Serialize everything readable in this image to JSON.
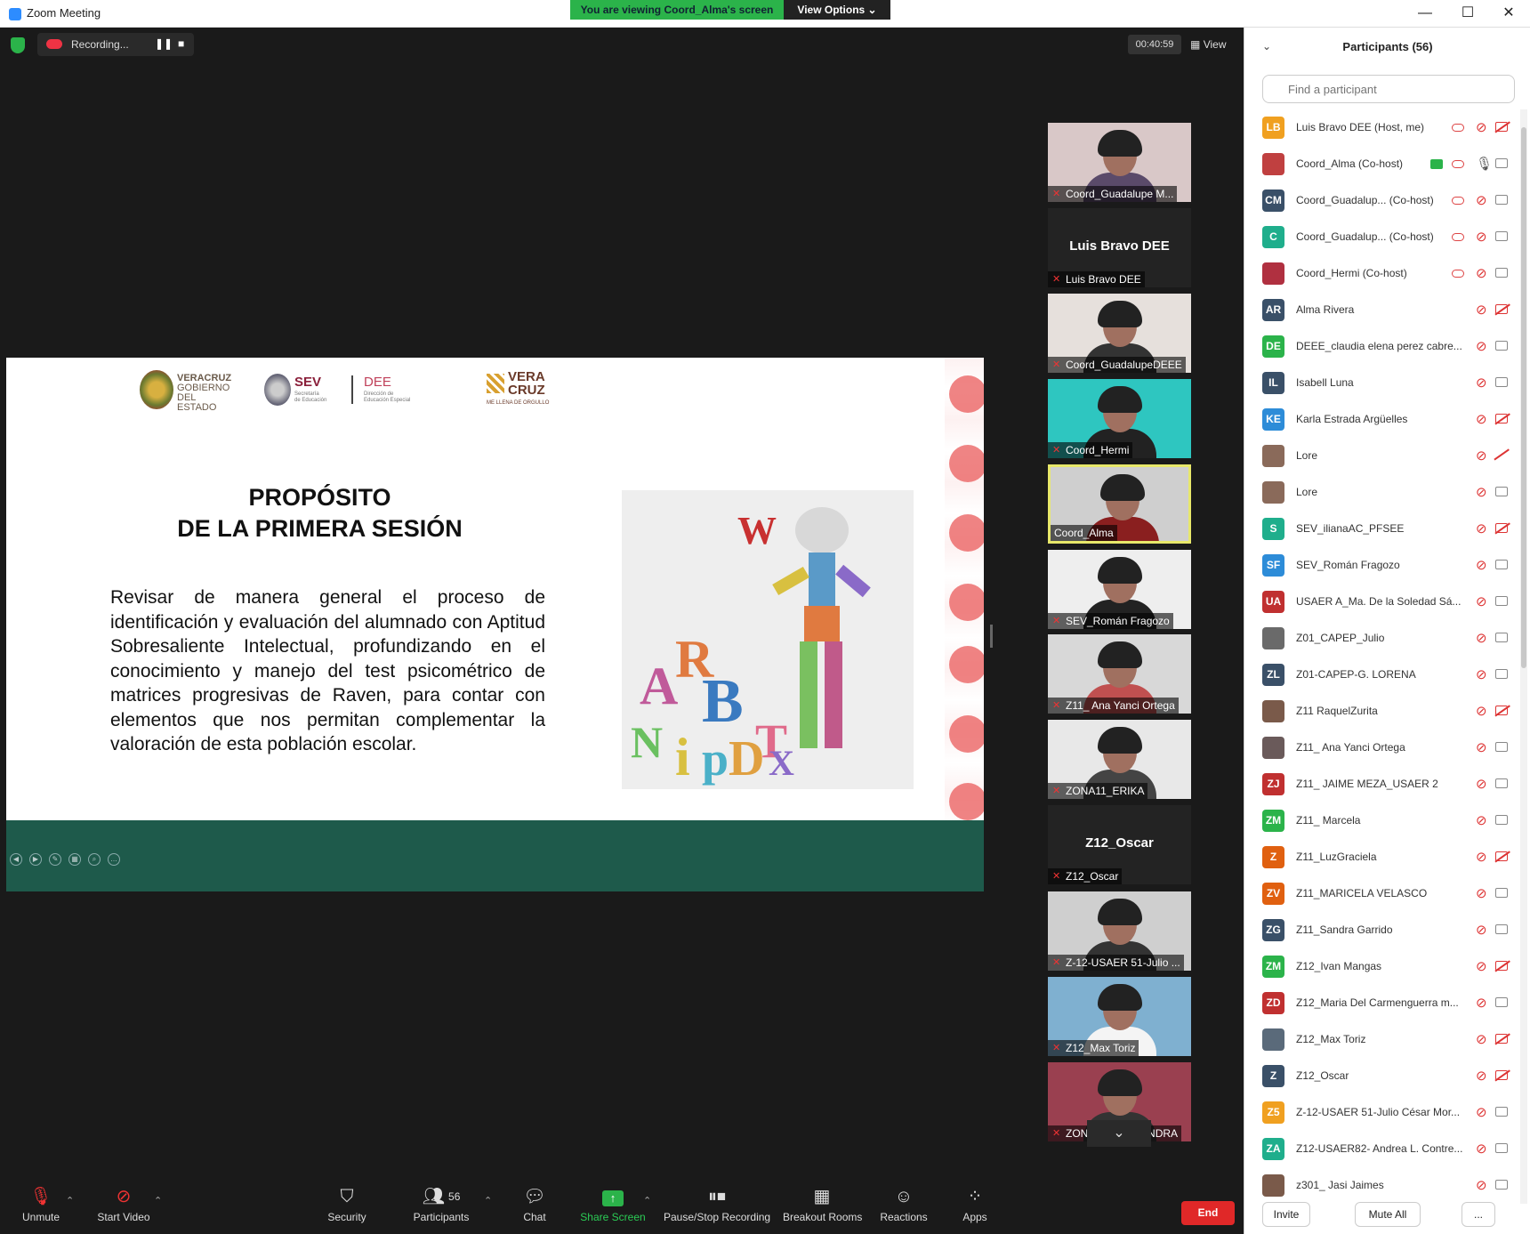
{
  "window": {
    "title": "Zoom Meeting",
    "minimize": "—",
    "maximize": "☐",
    "close": "✕"
  },
  "share_banner": {
    "viewing": "You are viewing Coord_Alma's screen",
    "view_options": "View Options ⌄"
  },
  "status": {
    "recording_label": "Recording...",
    "pause_icon": "❚❚",
    "stop_icon": "■",
    "timer": "00:40:59",
    "view_label": "View",
    "view_icon": "▦"
  },
  "slide": {
    "logos": {
      "veracruz": [
        "VERACRUZ",
        "GOBIERNO",
        "DEL ESTADO"
      ],
      "sev": "SEV",
      "sev_sub": [
        "Secretaría",
        "de Educación"
      ],
      "dee": "DEE",
      "dee_sub": [
        "Dirección de",
        "Educación Especial"
      ],
      "vera": "VERA",
      "cruz": "CRUZ",
      "vera_sub": "ME LLENA DE ORGULLO"
    },
    "heading_line1": "PROPÓSITO",
    "heading_line2": "DE LA PRIMERA SESIÓN",
    "body": "Revisar de manera general el proceso de identificación y evaluación del alumnado con Aptitud Sobresaliente Intelectual, profundizando en el conocimiento y manejo del test psicométrico de matrices progresivas de Raven, para contar con elementos que nos permitan complementar la valoración de esta población escolar."
  },
  "tiles": [
    {
      "name": "Coord_Guadalupe M...",
      "type": "video",
      "muted": true,
      "bg": "#d9c8c8",
      "shirt": "#5a4a6a"
    },
    {
      "name": "Luis Bravo DEE",
      "big_name": "Luis Bravo DEE",
      "type": "name",
      "muted": true
    },
    {
      "name": "Coord_GuadalupeDEEE",
      "type": "video",
      "muted": true,
      "bg": "#e6e0dc",
      "shirt": "#333"
    },
    {
      "name": "Coord_Hermi",
      "type": "video",
      "muted": true,
      "bg": "#2ec6c0",
      "shirt": "#222"
    },
    {
      "name": "Coord_Alma",
      "type": "video",
      "muted": false,
      "active": true,
      "bg": "#cfcfcf",
      "shirt": "#8a1f1f"
    },
    {
      "name": "SEV_Román Fragozo",
      "type": "video",
      "muted": true,
      "bg": "#eeeeee",
      "shirt": "#222"
    },
    {
      "name": "Z11_ Ana Yanci Ortega",
      "type": "video",
      "muted": true,
      "bg": "#d8d8d8",
      "shirt": "#c05050"
    },
    {
      "name": "ZONA11_ERIKA",
      "type": "video",
      "muted": true,
      "bg": "#e8e8e8",
      "shirt": "#444"
    },
    {
      "name": "Z12_Oscar",
      "big_name": "Z12_Oscar",
      "type": "name",
      "muted": true
    },
    {
      "name": "Z-12-USAER 51-Julio ...",
      "type": "video",
      "muted": true,
      "bg": "#cfcfcf",
      "shirt": "#333"
    },
    {
      "name": "Z12_Max Toriz",
      "type": "video",
      "muted": true,
      "bg": "#7fb0d0",
      "shirt": "#f4f4f4"
    },
    {
      "name": "ZONA01_ALEXANDRA",
      "type": "video",
      "muted": true,
      "bg": "#9a4050",
      "shirt": "#333"
    }
  ],
  "tiles_more_icon": "⌄",
  "toolbar": {
    "unmute": "Unmute",
    "start_video": "Start Video",
    "security": "Security",
    "participants": "Participants",
    "participants_count": "56",
    "chat": "Chat",
    "share_screen": "Share Screen",
    "pause_stop_recording": "Pause/Stop Recording",
    "breakout_rooms": "Breakout Rooms",
    "reactions": "Reactions",
    "apps": "Apps",
    "end": "End",
    "caret": "⌃"
  },
  "panel": {
    "title": "Participants (56)",
    "collapse_icon": "⌄",
    "search_placeholder": "Find a participant",
    "invite": "Invite",
    "mute_all": "Mute All",
    "more": "..."
  },
  "participants": [
    {
      "initials": "LB",
      "color": "#f0a020",
      "name": "Luis Bravo DEE (Host, me)",
      "cloud": true,
      "mic": "muted",
      "cam": "off"
    },
    {
      "initials": "",
      "color": "#c04040",
      "name": "Coord_Alma (Co-host)",
      "share": true,
      "cloud": true,
      "mic": "on",
      "cam": "on"
    },
    {
      "initials": "CM",
      "color": "#3a5068",
      "name": "Coord_Guadalup...  (Co-host)",
      "cloud": true,
      "mic": "muted",
      "cam": "on"
    },
    {
      "initials": "C",
      "color": "#1fae8c",
      "name": "Coord_Guadalup...  (Co-host)",
      "cloud": true,
      "mic": "muted",
      "cam": "on"
    },
    {
      "initials": "",
      "color": "#b03040",
      "name": "Coord_Hermi (Co-host)",
      "cloud": true,
      "mic": "muted",
      "cam": "on"
    },
    {
      "initials": "AR",
      "color": "#3a5068",
      "name": "Alma Rivera",
      "mic": "muted",
      "cam": "off"
    },
    {
      "initials": "DE",
      "color": "#2bb34a",
      "name": "DEEE_claudia elena perez cabre...",
      "mic": "muted",
      "cam": "on"
    },
    {
      "initials": "IL",
      "color": "#3a5068",
      "name": "Isabell Luna",
      "mic": "muted",
      "cam": "on"
    },
    {
      "initials": "KE",
      "color": "#2d8cd8",
      "name": "Karla Estrada Argüelles",
      "mic": "muted",
      "cam": "off"
    },
    {
      "initials": "",
      "color": "#8a6a5a",
      "name": "Lore",
      "mic": "muted",
      "cam": "none"
    },
    {
      "initials": "",
      "color": "#8a6a5a",
      "name": "Lore",
      "mic": "muted",
      "cam": "on"
    },
    {
      "initials": "S",
      "color": "#1fae8c",
      "name": "SEV_ilianaAC_PFSEE",
      "mic": "muted",
      "cam": "off"
    },
    {
      "initials": "SF",
      "color": "#2d8cd8",
      "name": "SEV_Román Fragozo",
      "mic": "muted",
      "cam": "on"
    },
    {
      "initials": "UA",
      "color": "#c03030",
      "name": "USAER A_Ma. De la Soledad Sá...",
      "mic": "muted",
      "cam": "on"
    },
    {
      "initials": "",
      "color": "#6a6a6a",
      "name": "Z01_CAPEP_Julio",
      "mic": "muted",
      "cam": "on"
    },
    {
      "initials": "ZL",
      "color": "#3a5068",
      "name": "Z01-CAPEP-G. LORENA",
      "mic": "muted",
      "cam": "on"
    },
    {
      "initials": "",
      "color": "#7a5a4a",
      "name": "Z11 RaquelZurita",
      "mic": "muted",
      "cam": "off"
    },
    {
      "initials": "",
      "color": "#6a5a5a",
      "name": "Z11_ Ana Yanci Ortega",
      "mic": "muted",
      "cam": "on"
    },
    {
      "initials": "ZJ",
      "color": "#c03030",
      "name": "Z11_ JAIME MEZA_USAER 2",
      "mic": "muted",
      "cam": "on"
    },
    {
      "initials": "ZM",
      "color": "#2bb34a",
      "name": "Z11_ Marcela",
      "mic": "muted",
      "cam": "on"
    },
    {
      "initials": "Z",
      "color": "#e06010",
      "name": "Z11_LuzGraciela",
      "mic": "muted",
      "cam": "off"
    },
    {
      "initials": "ZV",
      "color": "#e06010",
      "name": "Z11_MARICELA VELASCO",
      "mic": "muted",
      "cam": "on"
    },
    {
      "initials": "ZG",
      "color": "#3a5068",
      "name": "Z11_Sandra Garrido",
      "mic": "muted",
      "cam": "on"
    },
    {
      "initials": "ZM",
      "color": "#2bb34a",
      "name": "Z12_Ivan Mangas",
      "mic": "muted",
      "cam": "off"
    },
    {
      "initials": "ZD",
      "color": "#c03030",
      "name": "Z12_Maria Del Carmenguerra m...",
      "mic": "muted",
      "cam": "on"
    },
    {
      "initials": "",
      "color": "#5a6a7a",
      "name": "Z12_Max Toriz",
      "mic": "muted",
      "cam": "off"
    },
    {
      "initials": "Z",
      "color": "#3a5068",
      "name": "Z12_Oscar",
      "mic": "muted",
      "cam": "off"
    },
    {
      "initials": "Z5",
      "color": "#f0a020",
      "name": "Z-12-USAER 51-Julio César Mor...",
      "mic": "muted",
      "cam": "on"
    },
    {
      "initials": "ZA",
      "color": "#1fae8c",
      "name": "Z12-USAER82- Andrea L. Contre...",
      "mic": "muted",
      "cam": "on"
    },
    {
      "initials": "",
      "color": "#7a5a4a",
      "name": "z301_ Jasi Jaimes",
      "mic": "muted",
      "cam": "on"
    }
  ]
}
